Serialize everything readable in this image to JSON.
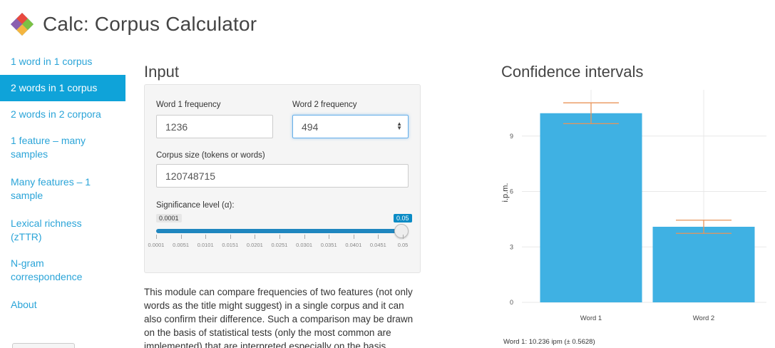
{
  "app": {
    "title": "Calc: Corpus Calculator"
  },
  "sidebar": {
    "items": [
      {
        "label": "1 word in 1 corpus",
        "active": false
      },
      {
        "label": "2 words in 1 corpus",
        "active": true
      },
      {
        "label": "2 words in 2 corpora",
        "active": false
      },
      {
        "label": "1 feature – many samples",
        "active": false
      },
      {
        "label": "Many features – 1 sample",
        "active": false
      },
      {
        "label": "Lexical richness (zTTR)",
        "active": false
      },
      {
        "label": "N-gram correspondence",
        "active": false
      },
      {
        "label": "About",
        "active": false
      }
    ]
  },
  "input": {
    "heading": "Input",
    "word1_label": "Word 1 frequency",
    "word1_value": "1236",
    "word2_label": "Word 2 frequency",
    "word2_value": "494",
    "corpus_label": "Corpus size (tokens or words)",
    "corpus_value": "120748715",
    "significance_label": "Significance level (α):",
    "slider": {
      "min_label": "0.0001",
      "value_label": "0.05",
      "min": 0.0001,
      "max": 0.05,
      "value": 0.05,
      "ticks": [
        "0.0001",
        "0.0051",
        "0.0101",
        "0.0151",
        "0.0201",
        "0.0251",
        "0.0301",
        "0.0351",
        "0.0401",
        "0.0451",
        "0.05"
      ]
    }
  },
  "description": "This module can compare frequencies of two features (not only words as the title might suggest) in a single corpus and it can also confirm their difference. Such a comparison may be drawn on the basis of statistical tests (only the most common are implemented) that are interpreted especially on the basis",
  "results": {
    "heading": "Confidence intervals",
    "stat_line": "Word 1: 10.236 ipm (± 0.5628)"
  },
  "chart_data": {
    "type": "bar",
    "categories": [
      "Word 1",
      "Word 2"
    ],
    "values": [
      10.236,
      4.091
    ],
    "errors": [
      0.5628,
      0.3567
    ],
    "ylabel": "i.p.m.",
    "ylim": [
      0,
      11.5
    ],
    "yticks": [
      "0",
      "3",
      "6",
      "9"
    ],
    "grid": true,
    "colors": {
      "bar": "#3fb1e3",
      "error": "#e8955a",
      "grid": "#e8e8e8"
    }
  }
}
